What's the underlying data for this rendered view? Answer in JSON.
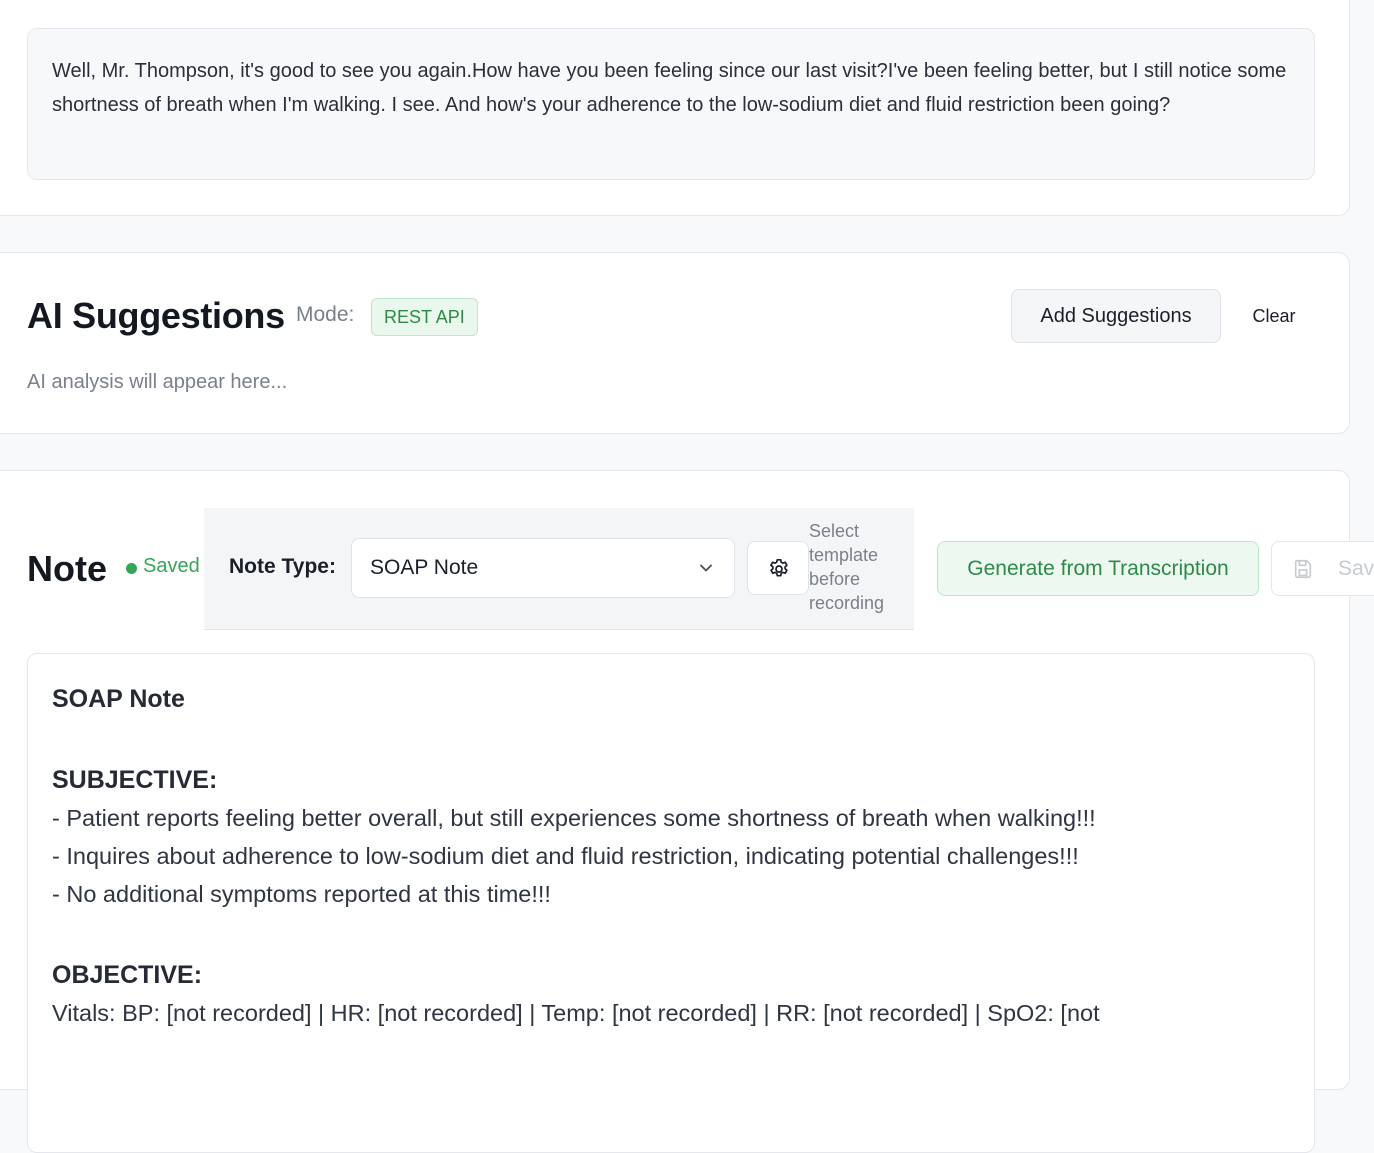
{
  "transcript": {
    "text": "Well, Mr. Thompson, it's good to see you again.How have you been feeling since our last visit?I've been feeling better, but I still notice some shortness of breath when I'm walking. I see. And how's your adherence to the low-sodium diet and fluid restriction been going?"
  },
  "ai_suggestions": {
    "title": "AI Suggestions",
    "mode_label": "Mode:",
    "mode_value": "REST API",
    "add_button": "Add Suggestions",
    "clear_button": "Clear",
    "placeholder": "AI analysis will appear here..."
  },
  "note": {
    "title": "Note",
    "status": "Saved",
    "note_type_label": "Note Type:",
    "note_type_value": "SOAP Note",
    "hint": "Select template before recording",
    "generate_button": "Generate from Transcription",
    "save_button": "Sav",
    "content": {
      "heading": "SOAP Note",
      "subjective_heading": "SUBJECTIVE:",
      "subjective_lines": [
        "- Patient reports feeling better overall, but still experiences some shortness of breath when walking!!!",
        "- Inquires about adherence to low-sodium diet and fluid restriction, indicating potential challenges!!!",
        "- No additional symptoms reported at this time!!!"
      ],
      "objective_heading": "OBJECTIVE:",
      "objective_lines": [
        "Vitals: BP: [not recorded] | HR: [not recorded] | Temp: [not recorded] | RR: [not recorded] | SpO2: [not"
      ]
    }
  },
  "colors": {
    "accent_blue": "#2f5de2",
    "success_green": "#36a55a"
  },
  "icons": {
    "settings": "gear-icon",
    "dropdown": "chevron-down-icon",
    "save": "save-icon",
    "status": "status-dot-icon"
  }
}
